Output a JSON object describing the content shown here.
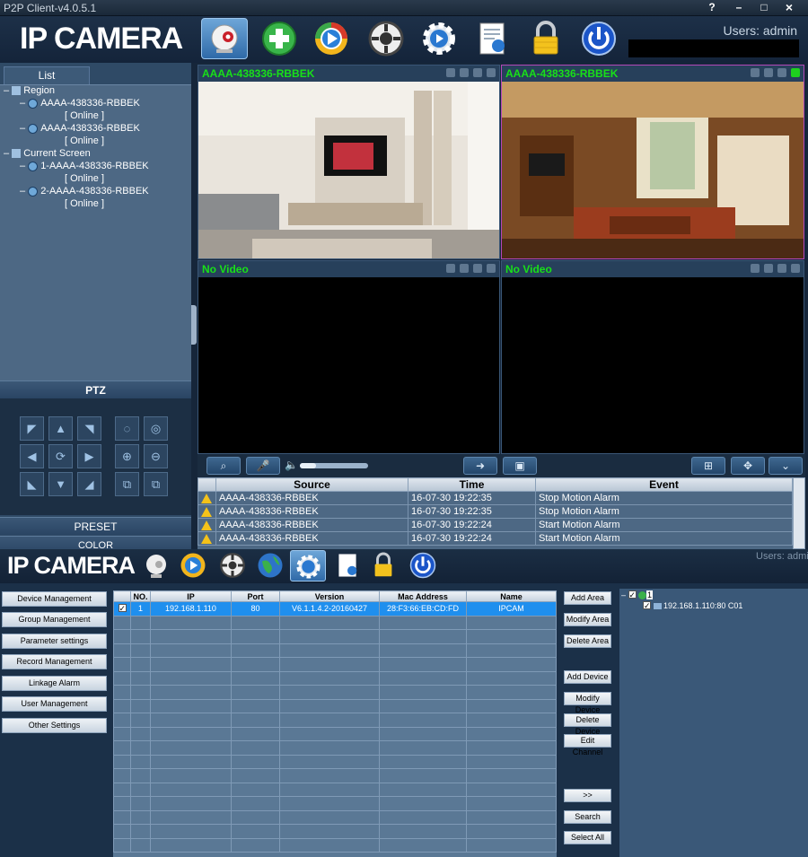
{
  "app": {
    "window_title": "P2P Client-v4.0.5.1",
    "logo": "IP CAMERA",
    "users_label": "Users: admin",
    "users_label_cut": "Users: admi"
  },
  "window_buttons": [
    "?",
    "–",
    "□",
    "×"
  ],
  "toolbar": [
    "camera-icon",
    "add-icon",
    "play-icon",
    "ptz-icon",
    "settings-icon",
    "document-icon",
    "lock-icon",
    "power-icon"
  ],
  "list": {
    "tab": "List",
    "tree": [
      {
        "label": "Region",
        "level": 0
      },
      {
        "label": "AAAA-438336-RBBEK",
        "level": 1,
        "cam": true
      },
      {
        "label": "[    Online    ]",
        "level": 2
      },
      {
        "label": "AAAA-438336-RBBEK",
        "level": 1,
        "cam": true
      },
      {
        "label": "[    Online    ]",
        "level": 2
      },
      {
        "label": "Current Screen",
        "level": 0
      },
      {
        "label": "1-AAAA-438336-RBBEK",
        "level": 1,
        "cam": true
      },
      {
        "label": "[    Online    ]",
        "level": 2
      },
      {
        "label": "2-AAAA-438336-RBBEK",
        "level": 1,
        "cam": true
      },
      {
        "label": "[    Online    ]",
        "level": 2
      }
    ]
  },
  "ptz": {
    "label": "PTZ",
    "preset": "PRESET",
    "color": "COLOR"
  },
  "video_cells": [
    {
      "title": "AAAA-438336-RBBEK",
      "kind": "living-room"
    },
    {
      "title": "AAAA-438336-RBBEK",
      "kind": "lounge"
    },
    {
      "title": "No Video",
      "kind": "none"
    },
    {
      "title": "No Video",
      "kind": "none"
    }
  ],
  "events": {
    "headers": [
      "Source",
      "Time",
      "Event"
    ],
    "rows": [
      [
        "AAAA-438336-RBBEK",
        "16-07-30 19:22:35",
        "Stop Motion Alarm"
      ],
      [
        "AAAA-438336-RBBEK",
        "16-07-30 19:22:35",
        "Stop Motion Alarm"
      ],
      [
        "AAAA-438336-RBBEK",
        "16-07-30 19:22:24",
        "Start Motion Alarm"
      ],
      [
        "AAAA-438336-RBBEK",
        "16-07-30 19:22:24",
        "Start Motion Alarm"
      ]
    ]
  },
  "settings": {
    "side_buttons": [
      "Device Management",
      "Group Management",
      "Parameter settings",
      "Record Management",
      "Linkage Alarm",
      "User Management",
      "Other Settings"
    ],
    "columns": [
      "",
      "NO.",
      "IP",
      "Port",
      "Version",
      "Mac Address",
      "Name"
    ],
    "devices": [
      [
        "✓",
        "1",
        "192.168.1.110",
        "80",
        "V6.1.1.4.2-20160427",
        "28:F3:66:EB:CD:FD",
        "IPCAM"
      ]
    ],
    "empty_rows": 17,
    "action_buttons": [
      "Add Area",
      "Modify Area",
      "Delete Area",
      "Add Device",
      "Modify Device",
      "Delete Device",
      "Edit Channel",
      ">>",
      "Search",
      "Select All"
    ],
    "tree_root": "1",
    "tree_child": "192.168.1.110:80 C01"
  },
  "colors": {
    "accent": "#18e018",
    "selected_row": "#1f8fee",
    "alert": "#f4c21a"
  }
}
